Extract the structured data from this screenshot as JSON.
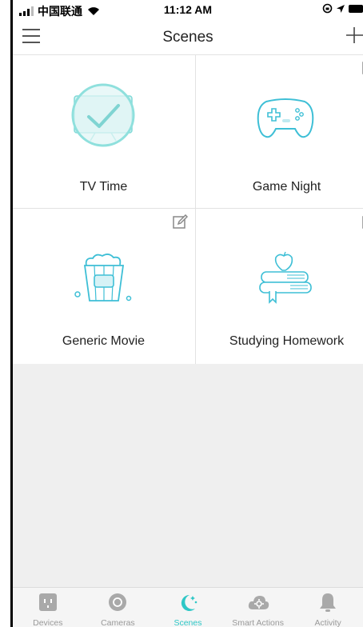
{
  "status_bar": {
    "carrier": "中国联通",
    "time": "11:12 AM"
  },
  "header": {
    "title": "Scenes"
  },
  "scenes": [
    {
      "label": "TV Time",
      "icon": "tv-check-icon",
      "editable": false
    },
    {
      "label": "Game Night",
      "icon": "gamepad-icon",
      "editable": true
    },
    {
      "label": "Generic Movie",
      "icon": "popcorn-icon",
      "editable": true
    },
    {
      "label": "Studying Homework",
      "icon": "books-apple-icon",
      "editable": true
    }
  ],
  "tabbar": {
    "tabs": [
      {
        "label": "Devices",
        "icon": "outlet-icon",
        "active": false
      },
      {
        "label": "Cameras",
        "icon": "camera-icon",
        "active": false
      },
      {
        "label": "Scenes",
        "icon": "moon-stars-icon",
        "active": true
      },
      {
        "label": "Smart Actions",
        "icon": "cloud-gear-icon",
        "active": false
      },
      {
        "label": "Activity",
        "icon": "bell-icon",
        "active": false
      }
    ]
  },
  "colors": {
    "accent": "#2ec7c6",
    "inactive_tab": "#9a9a9a",
    "divider": "#e2e2e2",
    "empty_bg": "#efefef"
  }
}
